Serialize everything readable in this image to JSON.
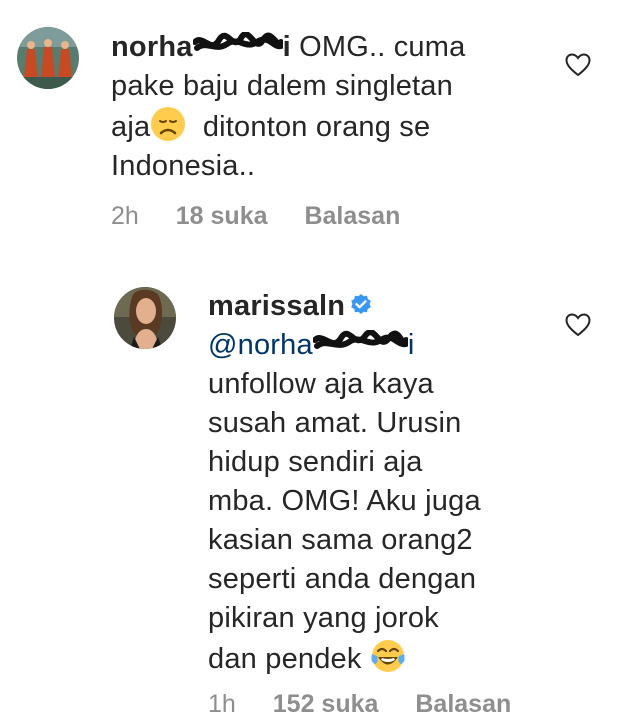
{
  "comments": [
    {
      "username_visible_start": "norha",
      "username_visible_end": "i",
      "line1_text": "OMG.. cuma",
      "line2": "pake baju dalem singletan",
      "line3_pre": "aja",
      "emoji1": "disappointed-face-emoji",
      "line3_post": "ditonton orang se",
      "line4": "Indonesia..",
      "time": "2h",
      "likes": "18 suka",
      "reply_label": "Balasan"
    },
    {
      "username": "marissaln",
      "verified_icon": "verified-badge-icon",
      "mention_visible_start": "@norha",
      "mention_visible_end": "i",
      "lines": [
        "unfollow aja kaya",
        "susah amat. Urusin",
        "hidup sendiri aja",
        "mba. OMG! Aku juga",
        "kasian sama orang2",
        "seperti anda dengan",
        "pikiran yang jorok"
      ],
      "last_line": "dan pendek",
      "emoji2": "face-with-tears-of-joy-emoji",
      "time": "1h",
      "likes": "152 suka",
      "reply_label": "Balasan"
    }
  ],
  "colors": {
    "text": "#262626",
    "meta": "#8e8e8e",
    "mention": "#003569",
    "verified": "#3897f0"
  }
}
